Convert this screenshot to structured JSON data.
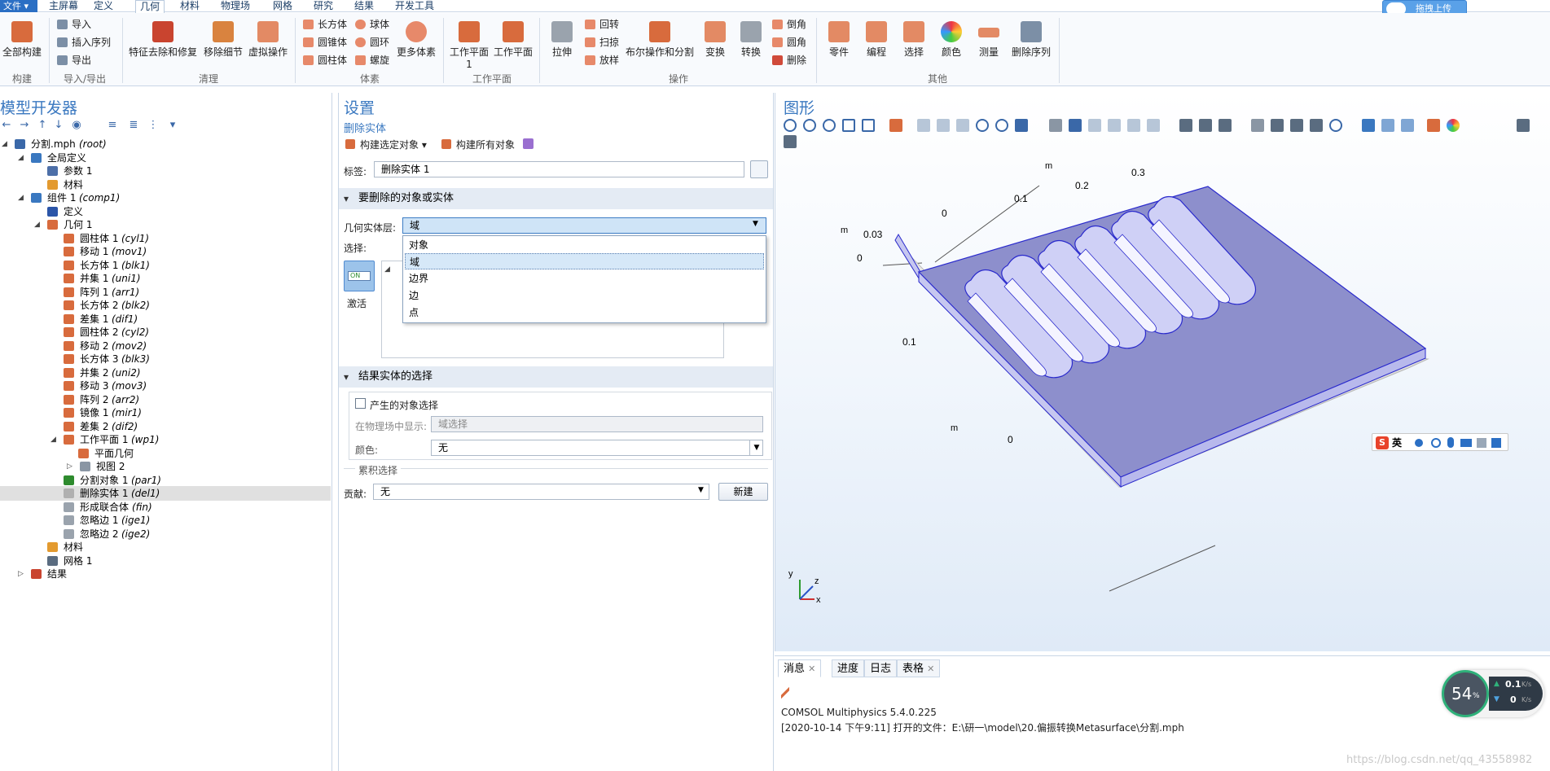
{
  "menubar": {
    "file": "文件 ▾",
    "tabs": [
      "主屏幕",
      "定义",
      "几何",
      "材料",
      "物理场",
      "网格",
      "研究",
      "结果",
      "开发工具"
    ],
    "upload": "拖拽上传"
  },
  "ribbon": {
    "build_all": "全部构建",
    "group_build": "构建",
    "import": "导入",
    "insert_sequence": "插入序列",
    "export": "导出",
    "group_import_export": "导入/导出",
    "feature_removal": "特征去除和修复",
    "remove_details": "移除细节",
    "virtual_ops": "虚拟操作",
    "group_cleanup": "清理",
    "block": "长方体",
    "cone": "圆锥体",
    "cylinder": "圆柱体",
    "sphere": "球体",
    "torus": "圆环",
    "helix": "螺旋",
    "more_primitives": "更多体素",
    "group_primitives": "体素",
    "work_plane_1": "工作平面 1",
    "work_plane": "工作平面",
    "group_work_plane": "工作平面",
    "extrude": "拉伸",
    "revolve": "回转",
    "sweep": "扫掠",
    "loft": "放样",
    "booleans": "布尔操作和分割",
    "transforms": "变换",
    "conversions": "转换",
    "chamfer": "倒角",
    "fillet": "圆角",
    "delete": "删除",
    "group_operations": "操作",
    "parts": "零件",
    "programming": "编程",
    "selections": "选择",
    "colors": "颜色",
    "measure": "测量",
    "delete_sequence": "删除序列",
    "group_other": "其他"
  },
  "model_builder": {
    "title": "模型开发器",
    "tree": [
      {
        "label": "分割.mph",
        "tag": "(root)"
      },
      {
        "label": "全局定义",
        "tag": ""
      },
      {
        "label": "参数 1",
        "tag": ""
      },
      {
        "label": "材料",
        "tag": ""
      },
      {
        "label": "组件 1",
        "tag": "(comp1)"
      },
      {
        "label": "定义",
        "tag": ""
      },
      {
        "label": "几何 1",
        "tag": ""
      },
      {
        "label": "圆柱体 1",
        "tag": "(cyl1)"
      },
      {
        "label": "移动 1",
        "tag": "(mov1)"
      },
      {
        "label": "长方体 1",
        "tag": "(blk1)"
      },
      {
        "label": "并集 1",
        "tag": "(uni1)"
      },
      {
        "label": "阵列 1",
        "tag": "(arr1)"
      },
      {
        "label": "长方体 2",
        "tag": "(blk2)"
      },
      {
        "label": "差集 1",
        "tag": "(dif1)"
      },
      {
        "label": "圆柱体 2",
        "tag": "(cyl2)"
      },
      {
        "label": "移动 2",
        "tag": "(mov2)"
      },
      {
        "label": "长方体 3",
        "tag": "(blk3)"
      },
      {
        "label": "并集 2",
        "tag": "(uni2)"
      },
      {
        "label": "移动 3",
        "tag": "(mov3)"
      },
      {
        "label": "阵列 2",
        "tag": "(arr2)"
      },
      {
        "label": "镜像 1",
        "tag": "(mir1)"
      },
      {
        "label": "差集 2",
        "tag": "(dif2)"
      },
      {
        "label": "工作平面 1",
        "tag": "(wp1)"
      },
      {
        "label": "平面几何",
        "tag": ""
      },
      {
        "label": "视图 2",
        "tag": ""
      },
      {
        "label": "分割对象 1",
        "tag": "(par1)"
      },
      {
        "label": "删除实体 1",
        "tag": "(del1)"
      },
      {
        "label": "形成联合体",
        "tag": "(fin)"
      },
      {
        "label": "忽略边 1",
        "tag": "(ige1)"
      },
      {
        "label": "忽略边 2",
        "tag": "(ige2)"
      },
      {
        "label": "材料",
        "tag": ""
      },
      {
        "label": "网格 1",
        "tag": ""
      },
      {
        "label": "结果",
        "tag": ""
      }
    ]
  },
  "settings": {
    "title": "设置",
    "subtitle": "删除实体",
    "build_selected": "构建选定对象",
    "build_all_objects": "构建所有对象",
    "label_caption": "标签:",
    "label_value": "删除实体 1",
    "section_entities": "要删除的对象或实体",
    "geom_level_caption": "几何实体层:",
    "geom_level_value": "域",
    "selection_caption": "选择:",
    "activate": "激活",
    "toggle_on": "ON",
    "dropdown_options": [
      "对象",
      "域",
      "边界",
      "边",
      "点"
    ],
    "section_result": "结果实体的选择",
    "resulting_selection": "产生的对象选择",
    "show_in_physics_caption": "在物理场中显示:",
    "show_in_physics_value": "域选择",
    "color_caption": "颜色:",
    "color_value": "无",
    "cumulative_header": "累积选择",
    "contribute_caption": "贡献:",
    "contribute_value": "无",
    "new_button": "新建"
  },
  "graphics": {
    "title": "图形",
    "axis_m_top": "m",
    "tick_02": "0.2",
    "tick_03": "0.3",
    "tick_01_top": "0.1",
    "tick_0_top": "0",
    "axis_m_left": "m",
    "tick_003": "0.03",
    "tick_0_left": "0",
    "tick_01_left": "0.1",
    "axis_m_bottom": "m",
    "tick_0_bottom": "0",
    "triad_y": "y",
    "triad_z": "z",
    "triad_x": "x",
    "ime_label": "英",
    "colors": {
      "top_face": "#8d8fcc",
      "side_face": "#c6c7f0",
      "front_face": "#e2e2e2",
      "edge": "#2a2acd"
    }
  },
  "messages": {
    "tabs": [
      "消息",
      "进度",
      "日志",
      "表格"
    ],
    "line1": "COMSOL Multiphysics 5.4.0.225",
    "line2": "[2020-10-14 下午9:11] 打开的文件：E:\\研一\\model\\20.偏振转换Metasurface\\分割.mph",
    "watermark": "https://blog.csdn.net/qq_43558982"
  },
  "speed": {
    "percent": "54",
    "unit": "%",
    "up": "0.1",
    "down": "0",
    "rate_unit": "K/s"
  }
}
